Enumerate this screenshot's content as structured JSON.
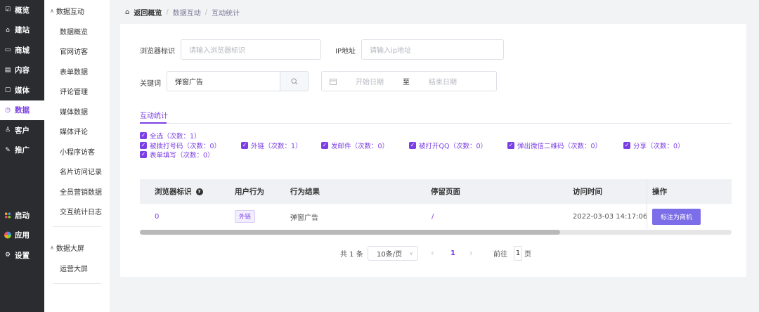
{
  "nav": {
    "items": [
      {
        "icon": "review-icon",
        "glyph": "☑",
        "label": "概览"
      },
      {
        "icon": "home-icon",
        "glyph": "⌂",
        "label": "建站"
      },
      {
        "icon": "shop-icon",
        "glyph": "▭",
        "label": "商城"
      },
      {
        "icon": "doc-icon",
        "glyph": "▤",
        "label": "内容"
      },
      {
        "icon": "media-icon",
        "glyph": "▢",
        "label": "媒体"
      },
      {
        "icon": "clock-icon",
        "glyph": "◷",
        "label": "数据"
      },
      {
        "icon": "user-icon",
        "glyph": "♙",
        "label": "客户"
      },
      {
        "icon": "promo-icon",
        "glyph": "✎",
        "label": "推广"
      }
    ],
    "bottom": [
      {
        "icon": "launch-icon",
        "label": "启动"
      },
      {
        "icon": "apps-icon",
        "label": "应用"
      },
      {
        "icon": "settings-icon",
        "glyph": "⚙",
        "label": "设置"
      }
    ]
  },
  "subnav": {
    "group1": "数据互动",
    "items": [
      "数据概览",
      "官网访客",
      "表单数据",
      "评论管理",
      "媒体数据",
      "媒体评论",
      "小程序访客",
      "名片访问记录",
      "全员营销数据",
      "交互统计日志"
    ],
    "group2": "数据大屏",
    "items2": [
      "运营大屏"
    ]
  },
  "breadcrumb": {
    "home": "返回概览",
    "sep": "/",
    "level1": "数据互动",
    "level2": "互动统计"
  },
  "filters": {
    "browser_label": "浏览器标识",
    "browser_placeholder": "请输入浏览器标识",
    "ip_label": "IP地址",
    "ip_placeholder": "请输入ip地址",
    "keyword_label": "关键词",
    "keyword_value": "弹窗广告",
    "start_placeholder": "开始日期",
    "range_sep": "至",
    "end_placeholder": "结束日期"
  },
  "tab": "互动统计",
  "checkboxes": [
    "全选（次数：1）",
    "被拨打号码（次数：0）",
    "外链（次数：1）",
    "发邮件（次数：0）",
    "被打开QQ（次数：0）",
    "弹出微信二维码（次数：0）",
    "分享（次数：0）",
    "表单填写（次数：0）"
  ],
  "table": {
    "headers": [
      "浏览器标识",
      "用户行为",
      "行为结果",
      "停留页面",
      "访问时间",
      "操作"
    ],
    "rows": [
      {
        "browser": "0",
        "behavior": "外链",
        "result": "弹窗广告",
        "page": "/",
        "time": "2022-03-03 14:17:06",
        "action": "标注为商机"
      }
    ]
  },
  "pagination": {
    "total": "共 1 条",
    "page_size": "10条/页",
    "prev": "‹",
    "current": "1",
    "next": "›",
    "goto_label": "前往",
    "goto_value": "1",
    "goto_suffix": "页"
  },
  "colors": {
    "accent": "#7b3fe4",
    "sidebar": "#2b2c30"
  }
}
